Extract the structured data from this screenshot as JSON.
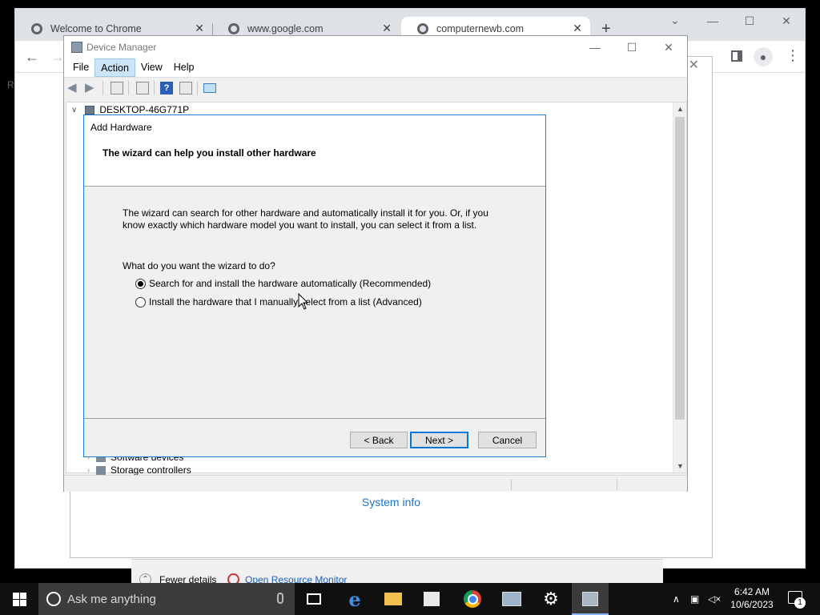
{
  "chrome": {
    "tabs": [
      {
        "title": "Welcome to Chrome"
      },
      {
        "title": "www.google.com"
      },
      {
        "title": "computernewb.com"
      }
    ],
    "new_tab": "+",
    "left_letter": "R"
  },
  "background_dialog": {
    "system_info_link": "System info",
    "fewer_details": "Fewer details",
    "open_resource_monitor": "Open Resource Monitor"
  },
  "device_manager": {
    "title": "Device Manager",
    "menu": [
      "File",
      "Action",
      "View",
      "Help"
    ],
    "tree_root": "DESKTOP-46G771P",
    "tree_items": [
      "Software devices",
      "Storage controllers"
    ]
  },
  "add_hardware": {
    "caption": "Add Hardware",
    "heading": "The wizard can help you install other hardware",
    "description": "The wizard can search for other hardware and automatically install it for you. Or, if you know exactly which hardware model you want to install, you can select it from a list.",
    "question": "What do you want the wizard to do?",
    "options": [
      {
        "label": "Search for and install the hardware automatically (Recommended)",
        "selected": true
      },
      {
        "label": "Install the hardware that I manually select from a list (Advanced)",
        "selected": false
      }
    ],
    "buttons": {
      "back": "< Back",
      "next": "Next >",
      "cancel": "Cancel"
    }
  },
  "taskbar": {
    "search_placeholder": "Ask me anything",
    "time": "6:42 AM",
    "date": "10/6/2023",
    "notification_count": "1",
    "icons": [
      "task-view-icon",
      "edge-icon",
      "file-explorer-icon",
      "store-icon",
      "chrome-icon",
      "photos-icon",
      "settings-icon",
      "device-manager-icon"
    ]
  }
}
